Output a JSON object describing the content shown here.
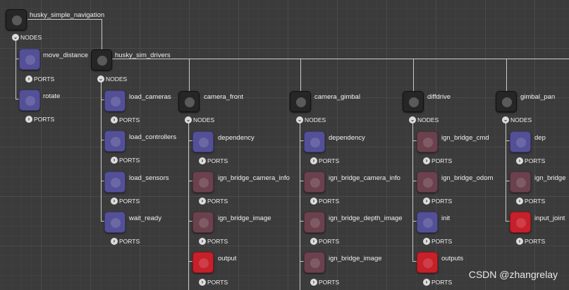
{
  "groups": {
    "husky_simple_navigation": "husky_simple_navigation",
    "husky_sim_drivers": "husky_sim_drivers",
    "camera_front": "camera_front",
    "camera_gimbal": "camera_gimbal",
    "diffdrive": "diffdrive",
    "gimbal_pan": "gimbal_pan"
  },
  "toggles": {
    "nodes": "NODES",
    "ports": "PORTS"
  },
  "nodes": {
    "move_distance": "move_distance",
    "rotate": "rotate",
    "load_cameras": "load_cameras",
    "load_controllers": "load_controllers",
    "load_sensors": "load_sensors",
    "wait_ready": "wait_ready",
    "cf_dependency": "dependency",
    "cf_ign_bridge_camera_info": "ign_bridge_camera_info",
    "cf_ign_bridge_image": "ign_bridge_image",
    "cf_output": "output",
    "cg_dependency": "dependency",
    "cg_ign_bridge_camera_info": "ign_bridge_camera_info",
    "cg_ign_bridge_depth_image": "ign_bridge_depth_image",
    "cg_ign_bridge_image": "ign_bridge_image",
    "dd_ign_bridge_cmd": "ign_bridge_cmd",
    "dd_ign_bridge_odom": "ign_bridge_odom",
    "dd_init": "init",
    "dd_outputs": "outputs",
    "gp_dep": "dep",
    "gp_ign_bridge": "ign_bridge",
    "gp_input_joint": "input_joint"
  },
  "watermark": "CSDN @zhangrelay",
  "colors": {
    "group": "#262626",
    "blue_node": "#545097",
    "mauve_node": "#6a414d",
    "red_node": "#c6202a",
    "wire": "#c9c9c9"
  }
}
